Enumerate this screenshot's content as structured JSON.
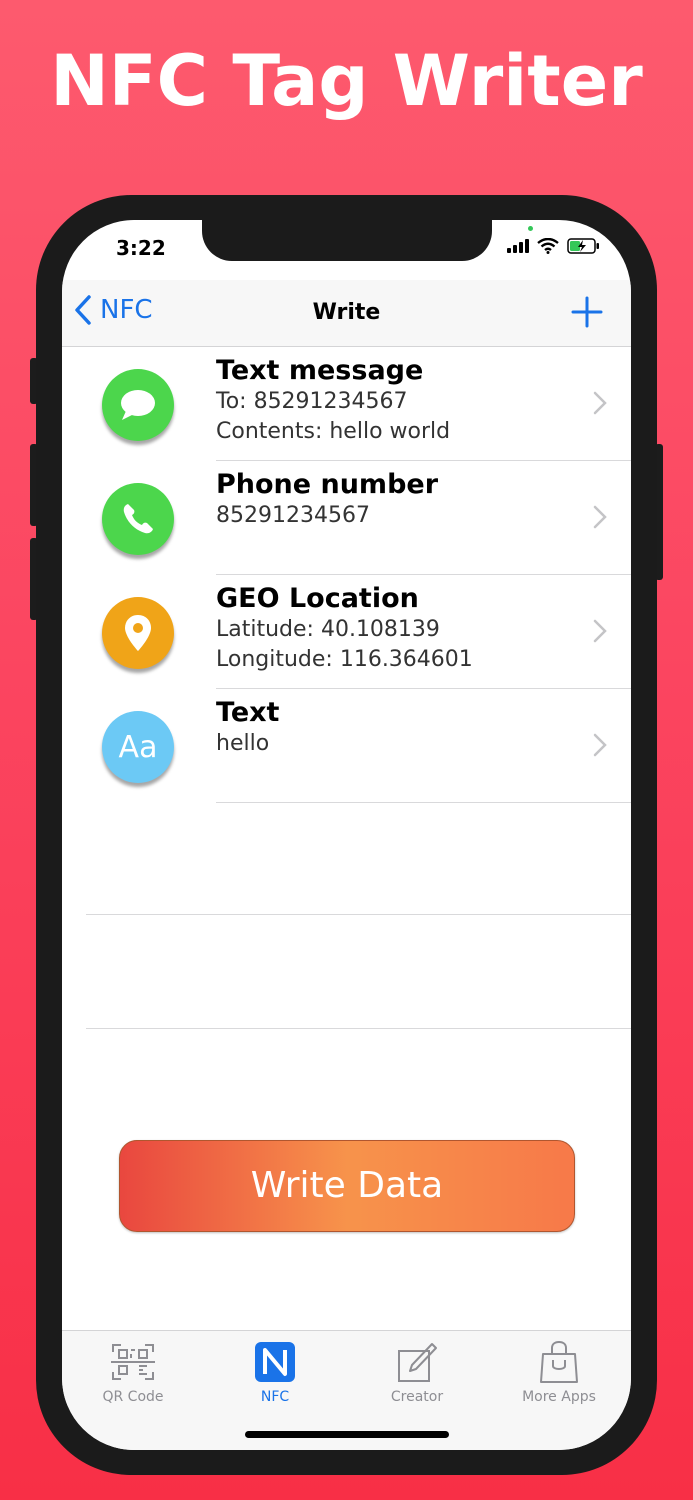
{
  "headline": "NFC Tag Writer",
  "status": {
    "time": "3:22"
  },
  "nav": {
    "back_label": "NFC",
    "title": "Write"
  },
  "items": [
    {
      "title": "Text message",
      "lines": [
        "To: 85291234567",
        "Contents: hello world"
      ],
      "icon": "message-bubble-icon",
      "color": "#4cd64c"
    },
    {
      "title": "Phone number",
      "lines": [
        "85291234567"
      ],
      "icon": "phone-handset-icon",
      "color": "#4cd64c"
    },
    {
      "title": "GEO Location",
      "lines": [
        "Latitude: 40.108139",
        "Longitude: 116.364601"
      ],
      "icon": "location-pin-icon",
      "color": "#f0a418"
    },
    {
      "title": "Text",
      "lines": [
        "hello"
      ],
      "icon": "text-aa-icon",
      "icon_text": "Aa",
      "color": "#6cc9f5"
    }
  ],
  "write_button": "Write Data",
  "tabs": [
    {
      "label": "QR Code",
      "icon": "qr-code-icon",
      "active": false
    },
    {
      "label": "NFC",
      "icon": "nfc-n-icon",
      "active": true
    },
    {
      "label": "Creator",
      "icon": "edit-pencil-icon",
      "active": false
    },
    {
      "label": "More Apps",
      "icon": "shopping-bag-icon",
      "active": false
    }
  ],
  "colors": {
    "accent": "#1a73e8",
    "background": "#fb4560",
    "button_from": "#e9473f",
    "button_to": "#f77949"
  }
}
